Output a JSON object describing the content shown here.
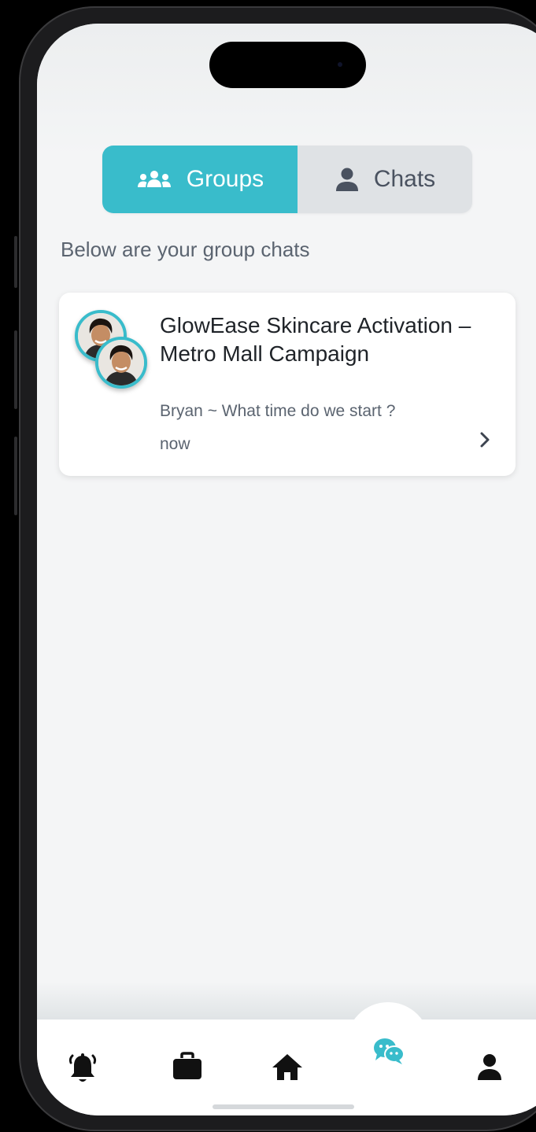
{
  "tabs": {
    "groups_label": "Groups",
    "chats_label": "Chats",
    "active": "Groups"
  },
  "subtitle": "Below are your group chats",
  "groups": [
    {
      "name": "GlowEase Skincare Activation – Metro Mall Campaign",
      "last_message": "Bryan  ~ What time do we start ?",
      "time": "now"
    }
  ],
  "bottom_nav": {
    "items": [
      "bell-icon",
      "briefcase-icon",
      "home-icon",
      "chat-icon",
      "user-icon"
    ],
    "active": "chat-icon"
  },
  "colors": {
    "accent": "#39bccb",
    "background": "#f4f5f6",
    "tab_inactive": "#dfe2e5",
    "text_primary": "#1f2328",
    "text_secondary": "#5b6470"
  }
}
